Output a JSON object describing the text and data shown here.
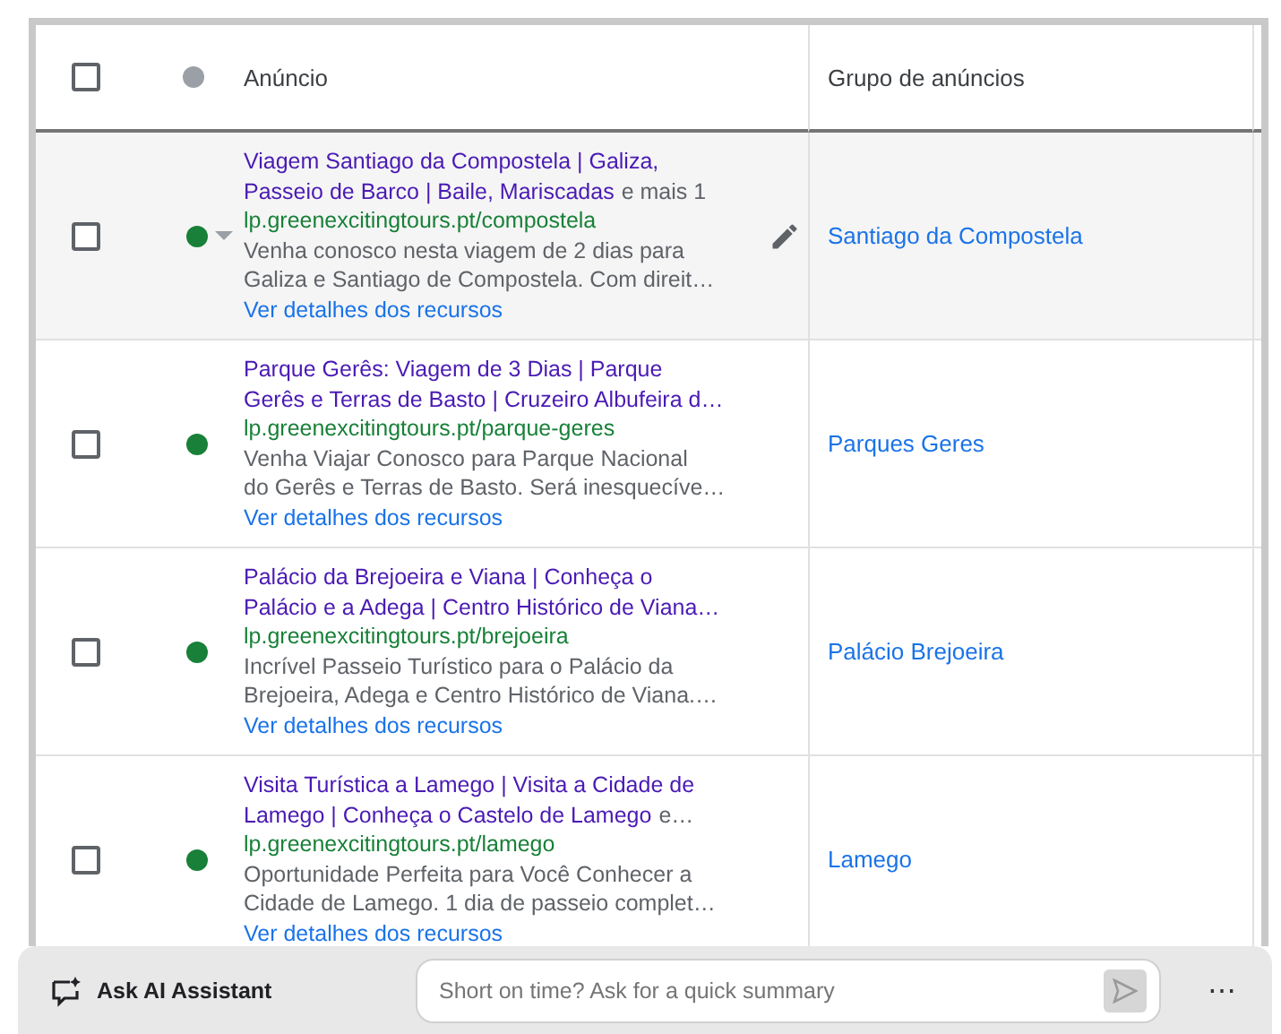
{
  "table": {
    "select_all_checked": false,
    "columns": [
      "Anúncio",
      "Grupo de anúncios"
    ],
    "rows": [
      {
        "checked": false,
        "hovered": true,
        "color": "#188038",
        "title_lines": [
          "Viagem Santiago da Compostela | Galiza,",
          "Passeio de Barco | Baile, Mariscadas"
        ],
        "more": "e mais 1",
        "url": "lp.greenexcitingtours.pt/compostela",
        "description_lines": [
          "Venha conosco nesta viagem de 2 dias para",
          "Galiza e Santiago de Compostela. Com direit…"
        ],
        "details_link": "Ver detalhes dos recursos",
        "ad_group": "Santiago da Compostela"
      },
      {
        "checked": false,
        "hovered": false,
        "color": "#188038",
        "title_lines": [
          "Parque Gerês: Viagem de 3 Dias | Parque",
          "Gerês e Terras de Basto | Cruzeiro Albufeira d…"
        ],
        "url": "lp.greenexcitingtours.pt/parque-geres",
        "description_lines": [
          "Venha Viajar Conosco para Parque Nacional",
          "do Gerês e Terras de Basto. Será inesquecíve…"
        ],
        "details_link": "Ver detalhes dos recursos",
        "ad_group": "Parques Geres"
      },
      {
        "checked": false,
        "hovered": false,
        "color": "#188038",
        "title_lines": [
          "Palácio da Brejoeira e Viana | Conheça o",
          "Palácio e a Adega | Centro Histórico de Viana…"
        ],
        "url": "lp.greenexcitingtours.pt/brejoeira",
        "description_lines": [
          "Incrível Passeio Turístico para o Palácio da",
          "Brejoeira, Adega e Centro Histórico de Viana.…"
        ],
        "details_link": "Ver detalhes dos recursos",
        "ad_group": "Palácio Brejoeira"
      },
      {
        "checked": false,
        "hovered": false,
        "color": "#188038",
        "title_lines": [
          "Visita Turística a Lamego | Visita a Cidade de",
          "Lamego | Conheça o Castelo de Lamego"
        ],
        "more": "e…",
        "url": "lp.greenexcitingtours.pt/lamego",
        "description_lines": [
          "Oportunidade Perfeita para Você Conhecer a",
          "Cidade de Lamego. 1 dia de passeio complet…"
        ],
        "details_link": "Ver detalhes dos recursos",
        "ad_group": "Lamego"
      }
    ]
  },
  "assistant_bar": {
    "label": "Ask AI Assistant",
    "placeholder": "Short on time? Ask for a quick summary",
    "more": "⋯"
  }
}
